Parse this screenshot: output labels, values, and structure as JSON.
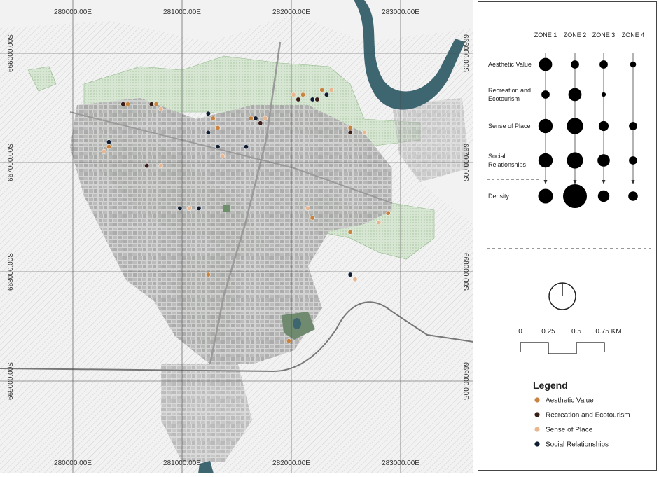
{
  "map": {
    "x_coords": [
      "280000.00E",
      "281000.00E",
      "282000.00E",
      "283000.00E"
    ],
    "y_coords": [
      "666000.00S",
      "667000.00S",
      "668000.00S",
      "669000.00S"
    ],
    "points": [
      {
        "type": "aesthetic",
        "x": 0.27,
        "y": 0.22
      },
      {
        "type": "recreation",
        "x": 0.26,
        "y": 0.22
      },
      {
        "type": "aesthetic",
        "x": 0.33,
        "y": 0.22
      },
      {
        "type": "recreation",
        "x": 0.32,
        "y": 0.22
      },
      {
        "type": "sense",
        "x": 0.34,
        "y": 0.23
      },
      {
        "type": "aesthetic",
        "x": 0.23,
        "y": 0.31
      },
      {
        "type": "social",
        "x": 0.23,
        "y": 0.3
      },
      {
        "type": "sense",
        "x": 0.22,
        "y": 0.32
      },
      {
        "type": "recreation",
        "x": 0.31,
        "y": 0.35
      },
      {
        "type": "sense",
        "x": 0.34,
        "y": 0.35
      },
      {
        "type": "social",
        "x": 0.44,
        "y": 0.24
      },
      {
        "type": "aesthetic",
        "x": 0.45,
        "y": 0.25
      },
      {
        "type": "social",
        "x": 0.44,
        "y": 0.28
      },
      {
        "type": "aesthetic",
        "x": 0.46,
        "y": 0.27
      },
      {
        "type": "recreation",
        "x": 0.46,
        "y": 0.31
      },
      {
        "type": "social",
        "x": 0.46,
        "y": 0.31
      },
      {
        "type": "sense",
        "x": 0.47,
        "y": 0.33
      },
      {
        "type": "aesthetic",
        "x": 0.52,
        "y": 0.31
      },
      {
        "type": "social",
        "x": 0.54,
        "y": 0.25
      },
      {
        "type": "recreation",
        "x": 0.55,
        "y": 0.26
      },
      {
        "type": "sense",
        "x": 0.56,
        "y": 0.25
      },
      {
        "type": "aesthetic",
        "x": 0.53,
        "y": 0.25
      },
      {
        "type": "sense",
        "x": 0.62,
        "y": 0.2
      },
      {
        "type": "recreation",
        "x": 0.63,
        "y": 0.21
      },
      {
        "type": "aesthetic",
        "x": 0.64,
        "y": 0.2
      },
      {
        "type": "social",
        "x": 0.66,
        "y": 0.21
      },
      {
        "type": "recreation",
        "x": 0.67,
        "y": 0.21
      },
      {
        "type": "aesthetic",
        "x": 0.68,
        "y": 0.19
      },
      {
        "type": "sense",
        "x": 0.7,
        "y": 0.19
      },
      {
        "type": "social",
        "x": 0.69,
        "y": 0.2
      },
      {
        "type": "aesthetic",
        "x": 0.74,
        "y": 0.27
      },
      {
        "type": "recreation",
        "x": 0.74,
        "y": 0.28
      },
      {
        "type": "sense",
        "x": 0.77,
        "y": 0.28
      },
      {
        "type": "social",
        "x": 0.38,
        "y": 0.44
      },
      {
        "type": "social",
        "x": 0.42,
        "y": 0.44
      },
      {
        "type": "sense",
        "x": 0.4,
        "y": 0.44
      },
      {
        "type": "aesthetic",
        "x": 0.66,
        "y": 0.46
      },
      {
        "type": "sense",
        "x": 0.65,
        "y": 0.44
      },
      {
        "type": "aesthetic",
        "x": 0.74,
        "y": 0.49
      },
      {
        "type": "aesthetic",
        "x": 0.82,
        "y": 0.45
      },
      {
        "type": "sense",
        "x": 0.8,
        "y": 0.47
      },
      {
        "type": "social",
        "x": 0.74,
        "y": 0.58
      },
      {
        "type": "sense",
        "x": 0.75,
        "y": 0.59
      },
      {
        "type": "aesthetic",
        "x": 0.44,
        "y": 0.58
      },
      {
        "type": "aesthetic",
        "x": 0.61,
        "y": 0.72
      },
      {
        "type": "social",
        "x": 0.52,
        "y": 0.31
      }
    ]
  },
  "zones": {
    "headers": [
      "ZONE 1",
      "ZONE 2",
      "ZONE 3",
      "ZONE 4"
    ],
    "rows": [
      {
        "label_lines": [
          "Aesthetic Value"
        ],
        "sizes": [
          0.55,
          0.35,
          0.35,
          0.25
        ]
      },
      {
        "label_lines": [
          "Recreation and",
          "Ecotourism"
        ],
        "sizes": [
          0.35,
          0.55,
          0.18,
          0
        ]
      },
      {
        "label_lines": [
          "Sense of Place"
        ],
        "sizes": [
          0.6,
          0.68,
          0.42,
          0.35
        ]
      },
      {
        "label_lines": [
          "Social",
          "Relationships"
        ],
        "sizes": [
          0.6,
          0.68,
          0.52,
          0.35
        ]
      },
      {
        "label_lines": [
          "Density"
        ],
        "sizes": [
          0.62,
          1.0,
          0.48,
          0.4
        ]
      }
    ]
  },
  "scale": {
    "labels": [
      "0",
      "0.25",
      "0.5",
      "0.75 KM"
    ]
  },
  "legend": {
    "title": "Legend",
    "items": [
      {
        "key": "aesthetic",
        "label": "Aesthetic Value",
        "color": "#c8843e"
      },
      {
        "key": "recreation",
        "label": "Recreation and Ecotourism",
        "color": "#3a1e18"
      },
      {
        "key": "sense",
        "label": "Sense of Place",
        "color": "#e8b690"
      },
      {
        "key": "social",
        "label": "Social Relationships",
        "color": "#0f1d33"
      }
    ]
  },
  "colors": {
    "river": "#3d6670",
    "green": "#c9dec4",
    "urban": "#b4b4b4"
  }
}
